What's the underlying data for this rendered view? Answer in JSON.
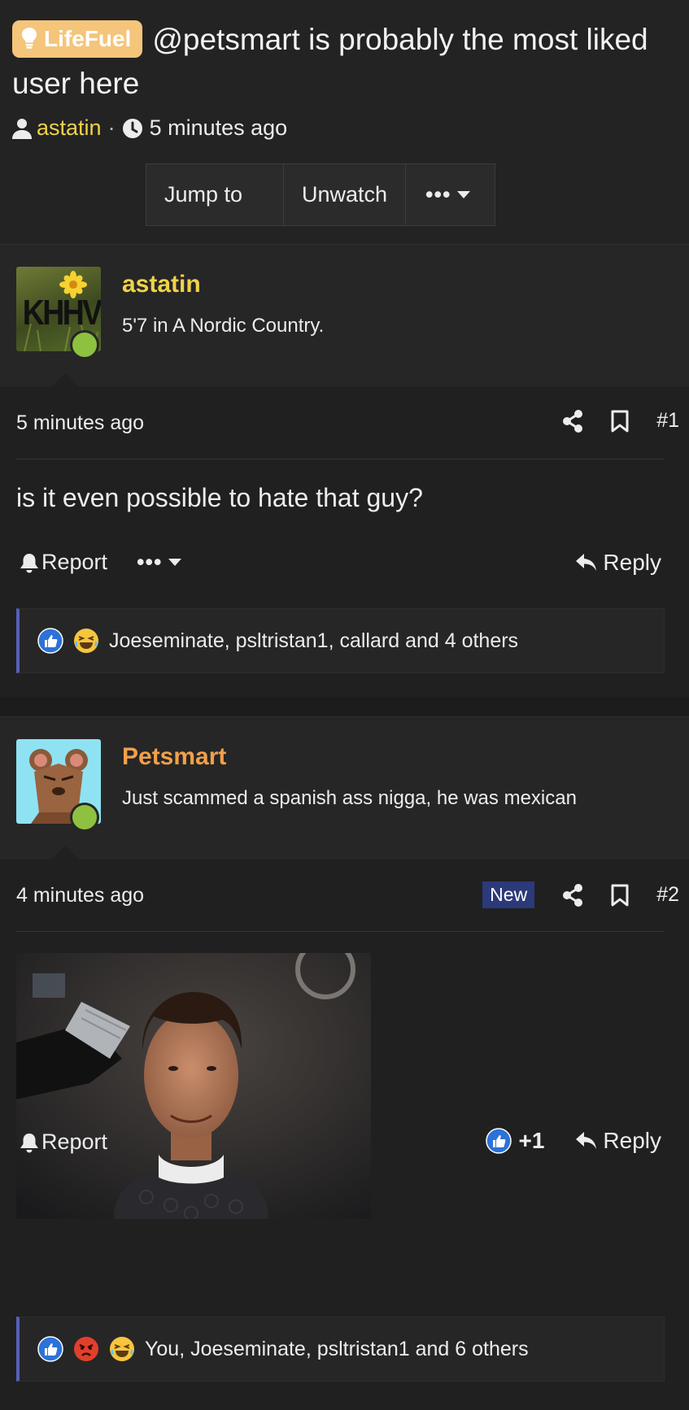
{
  "thread": {
    "prefix": "LifeFuel",
    "title": "@petsmart is probably the most liked user here",
    "author": "astatin",
    "separator": "·",
    "time": "5 minutes ago",
    "buttons": {
      "jump": "Jump to new",
      "unwatch": "Unwatch",
      "more": "•••"
    }
  },
  "posts": [
    {
      "username": "astatin",
      "username_color": "#f0d24a",
      "user_title": "5'7 in A Nordic Country.",
      "avatar_text": "KHHV",
      "time": "5 minutes ago",
      "number": "#1",
      "text": "is it even possible to hate that guy?",
      "report": "Report",
      "more": "•••",
      "reply": "Reply",
      "reactions_text": "Joeseminate, psltristan1, callard and 4 others"
    },
    {
      "username": "Petsmart",
      "username_color": "#f2a04a",
      "user_title": "Just scammed a spanish ass nigga, he was mexican",
      "time": "4 minutes ago",
      "new_badge": "New",
      "number": "#2",
      "report": "Report",
      "like_count": "+1",
      "reply": "Reply",
      "reactions_text": "You, Joeseminate, psltristan1 and 6 others"
    }
  ],
  "colors": {
    "accent": "#5560b8",
    "online": "#8ec13f",
    "prefix_bg": "#f4c57a",
    "new_badge": "#2c3a7a"
  },
  "icons": [
    "lightbulb-icon",
    "user-icon",
    "clock-icon",
    "share-icon",
    "bookmark-icon",
    "bell-icon",
    "reply-icon",
    "like-icon",
    "haha-icon",
    "angry-icon"
  ]
}
